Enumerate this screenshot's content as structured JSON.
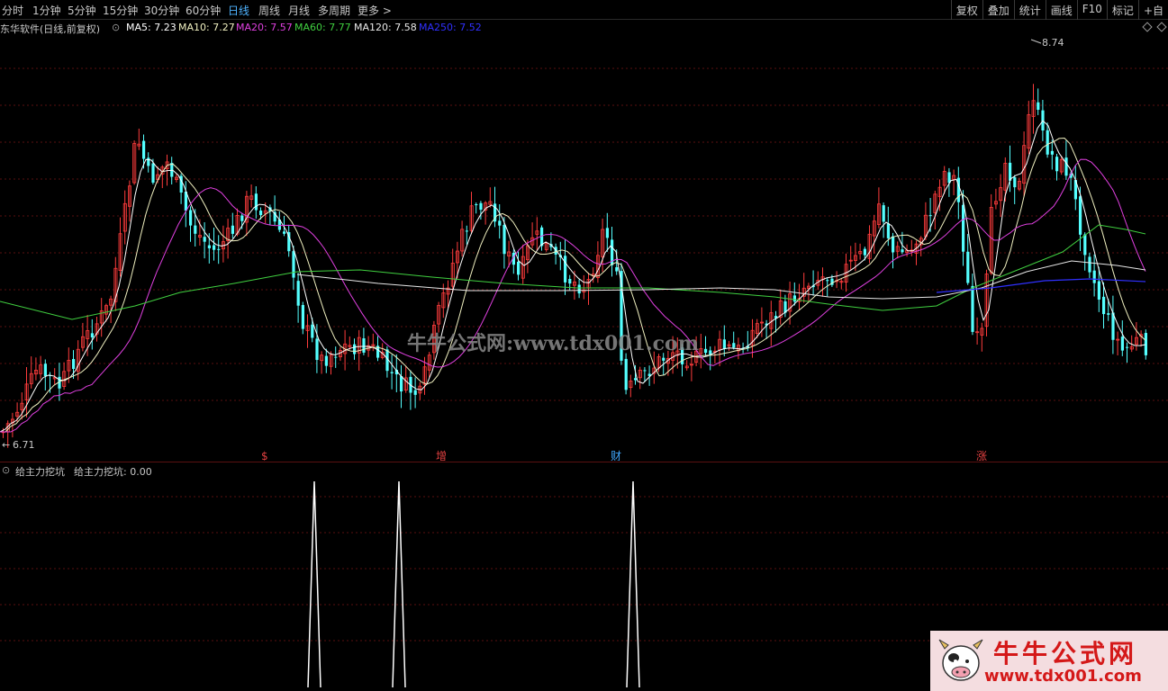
{
  "toolbar": {
    "timeframes": [
      "分时",
      "1分钟",
      "5分钟",
      "15分钟",
      "30分钟",
      "60分钟",
      "日线",
      "周线",
      "月线",
      "多周期",
      "更多 >"
    ],
    "active_timeframe": "日线",
    "tools": [
      "复权",
      "叠加",
      "统计",
      "画线",
      "F10",
      "标记",
      "+自"
    ]
  },
  "legend": {
    "stock_label": "东华软件(日线,前复权)",
    "ma5": "MA5: 7.23",
    "ma10": "MA10: 7.27",
    "ma20": "MA20: 7.57",
    "ma60": "MA60: 7.77",
    "ma120": "MA120: 7.58",
    "ma250": "MA250: 7.52",
    "colors": {
      "ma5": "#ffffff",
      "ma10": "#f0f0c0",
      "ma20": "#e040e0",
      "ma60": "#40d040",
      "ma120": "#e8e8e8",
      "ma250": "#3030ff"
    }
  },
  "price": {
    "high_label": "8.74",
    "low_label": "6.71"
  },
  "signals": [
    {
      "label": "$",
      "color": "#e04040"
    },
    {
      "label": "增",
      "color": "#e04040"
    },
    {
      "label": "财",
      "color": "#40a8ff"
    },
    {
      "label": "涨",
      "color": "#e04040"
    }
  ],
  "indicator": {
    "name": "给主力挖坑",
    "value_text": "给主力挖坑: 0.00"
  },
  "watermark": "牛牛公式网:www.tdx001.com",
  "badge": {
    "title": "牛牛公式网",
    "url": "www.tdx001.com"
  },
  "colors": {
    "up": "#ff3c3c",
    "down": "#54ffff",
    "grid": "#5a1010"
  }
}
